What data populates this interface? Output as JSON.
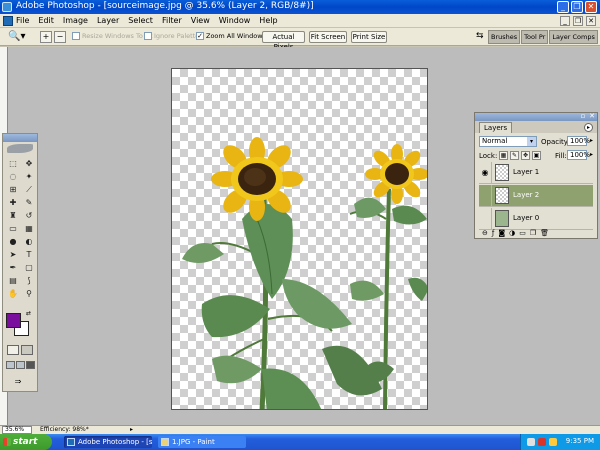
{
  "window": {
    "title": "Adobe Photoshop - [sourceimage.jpg @ 35.6% (Layer 2, RGB/8#)]",
    "minimize_label": "_",
    "restore_label": "❐",
    "close_label": "✕"
  },
  "menubar": {
    "items": [
      "File",
      "Edit",
      "Image",
      "Layer",
      "Select",
      "Filter",
      "View",
      "Window",
      "Help"
    ]
  },
  "options": {
    "tool_icon": "zoom-icon",
    "resize_windows": {
      "label": "Resize Windows To Fit",
      "checked": false,
      "enabled": false
    },
    "ignore_palettes": {
      "label": "Ignore Palettes",
      "checked": false,
      "enabled": false
    },
    "zoom_all": {
      "label": "Zoom All Windows",
      "checked": true,
      "enabled": true,
      "mark": "✓"
    },
    "buttons": [
      "Actual Pixels",
      "Fit Screen",
      "Print Size"
    ],
    "palette_well_tabs": [
      "Brushes",
      "Tool Pr",
      "Layer Comps"
    ]
  },
  "tools": {
    "foreground_color": "#7a0f9e",
    "background_color": "#ffffff",
    "icons": [
      "marquee-icon",
      "move-icon",
      "lasso-icon",
      "magic-wand-icon",
      "crop-icon",
      "slice-icon",
      "healing-brush-icon",
      "brush-icon",
      "clone-stamp-icon",
      "history-brush-icon",
      "eraser-icon",
      "gradient-icon",
      "blur-icon",
      "dodge-icon",
      "path-selection-icon",
      "type-icon",
      "pen-icon",
      "shape-icon",
      "notes-icon",
      "eyedropper-icon",
      "hand-icon",
      "zoom-icon"
    ]
  },
  "layers_panel": {
    "tab_label": "Layers",
    "blend_mode": "Normal",
    "opacity_label": "Opacity:",
    "opacity_value": "100%",
    "lock_label": "Lock:",
    "fill_label": "Fill:",
    "fill_value": "100%",
    "layers": [
      {
        "name": "Layer 1",
        "visible": true,
        "active": false
      },
      {
        "name": "Layer 2",
        "visible": false,
        "active": true
      },
      {
        "name": "Layer 0",
        "visible": false,
        "active": false
      }
    ]
  },
  "statusbar": {
    "zoom": "35.6%",
    "info": "Efficiency: 98%*"
  },
  "taskbar": {
    "start_label": "start",
    "tasks": [
      {
        "label": "Adobe Photoshop - [s...",
        "active": true
      },
      {
        "label": "1.JPG - Paint",
        "active": false
      }
    ],
    "clock": "9:35 PM"
  }
}
